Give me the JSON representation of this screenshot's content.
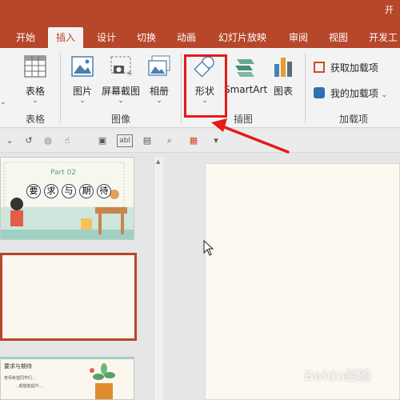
{
  "window": {
    "title": "开"
  },
  "tabs": [
    "开始",
    "插入",
    "设计",
    "切换",
    "动画",
    "幻灯片放映",
    "审阅",
    "视图",
    "开发工"
  ],
  "active_tab": "插入",
  "ribbon": {
    "table_label": "表格",
    "picture_label": "图片",
    "screenshot_label": "屏幕截图",
    "album_label": "相册",
    "shapes_label": "形状",
    "smartart_label": "SmartArt",
    "chart_label": "图表",
    "get_addins_label": "获取加载项",
    "my_addins_label": "我的加载项",
    "groups": {
      "tables": "表格",
      "images": "图像",
      "illustrations": "插图",
      "addins": "加载项"
    }
  },
  "quick_toolbar": {
    "icons": [
      "undo-icon",
      "present-icon",
      "touch-mode-icon",
      "picture-icon",
      "textbox-icon",
      "layout-icon",
      "find-icon",
      "slide-icon",
      "customize-icon"
    ],
    "label_text": "abl"
  },
  "slides": {
    "slide1": {
      "part": "Part 02",
      "chars": [
        "要",
        "求",
        "与",
        "期",
        "待"
      ]
    },
    "slide3": {
      "title": "要求与期待",
      "line1": "老师希望同学们...",
      "line2": "...期望能提升..."
    }
  },
  "watermark": "Baidu经验",
  "colors": {
    "accent": "#b7472a",
    "highlight": "#e31b1b",
    "teal": "#9ed0c3"
  }
}
